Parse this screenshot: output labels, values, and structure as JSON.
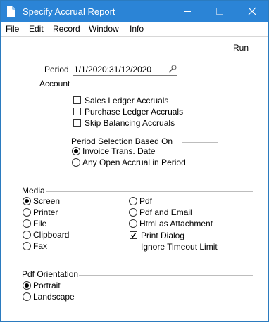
{
  "window": {
    "title": "Specify Accrual Report"
  },
  "menu": [
    "File",
    "Edit",
    "Record",
    "Window",
    "Info"
  ],
  "toolbar": {
    "run_label": "Run"
  },
  "form": {
    "period_label": "Period",
    "period_value": "1/1/2020:31/12/2020",
    "account_label": "Account",
    "account_value": "",
    "checks": [
      {
        "label": "Sales Ledger Accruals",
        "checked": false
      },
      {
        "label": "Purchase Ledger Accruals",
        "checked": false
      },
      {
        "label": "Skip Balancing Accruals",
        "checked": false
      }
    ],
    "period_selection": {
      "title": "Period Selection Based On",
      "options": [
        {
          "label": "Invoice Trans. Date",
          "selected": true
        },
        {
          "label": "Any Open Accrual in Period",
          "selected": false
        }
      ]
    },
    "media": {
      "title": "Media",
      "options_left": [
        {
          "label": "Screen",
          "selected": true
        },
        {
          "label": "Printer",
          "selected": false
        },
        {
          "label": "File",
          "selected": false
        },
        {
          "label": "Clipboard",
          "selected": false
        },
        {
          "label": "Fax",
          "selected": false
        }
      ],
      "options_right": [
        {
          "label": "Pdf",
          "selected": false
        },
        {
          "label": "Pdf and Email",
          "selected": false
        },
        {
          "label": "Html as Attachment",
          "selected": false
        }
      ],
      "print_dialog": {
        "label": "Print Dialog",
        "checked": true
      },
      "ignore_timeout": {
        "label": "Ignore Timeout Limit",
        "checked": false
      }
    },
    "pdf_orientation": {
      "title": "Pdf Orientation",
      "options": [
        {
          "label": "Portrait",
          "selected": true
        },
        {
          "label": "Landscape",
          "selected": false
        }
      ]
    }
  }
}
